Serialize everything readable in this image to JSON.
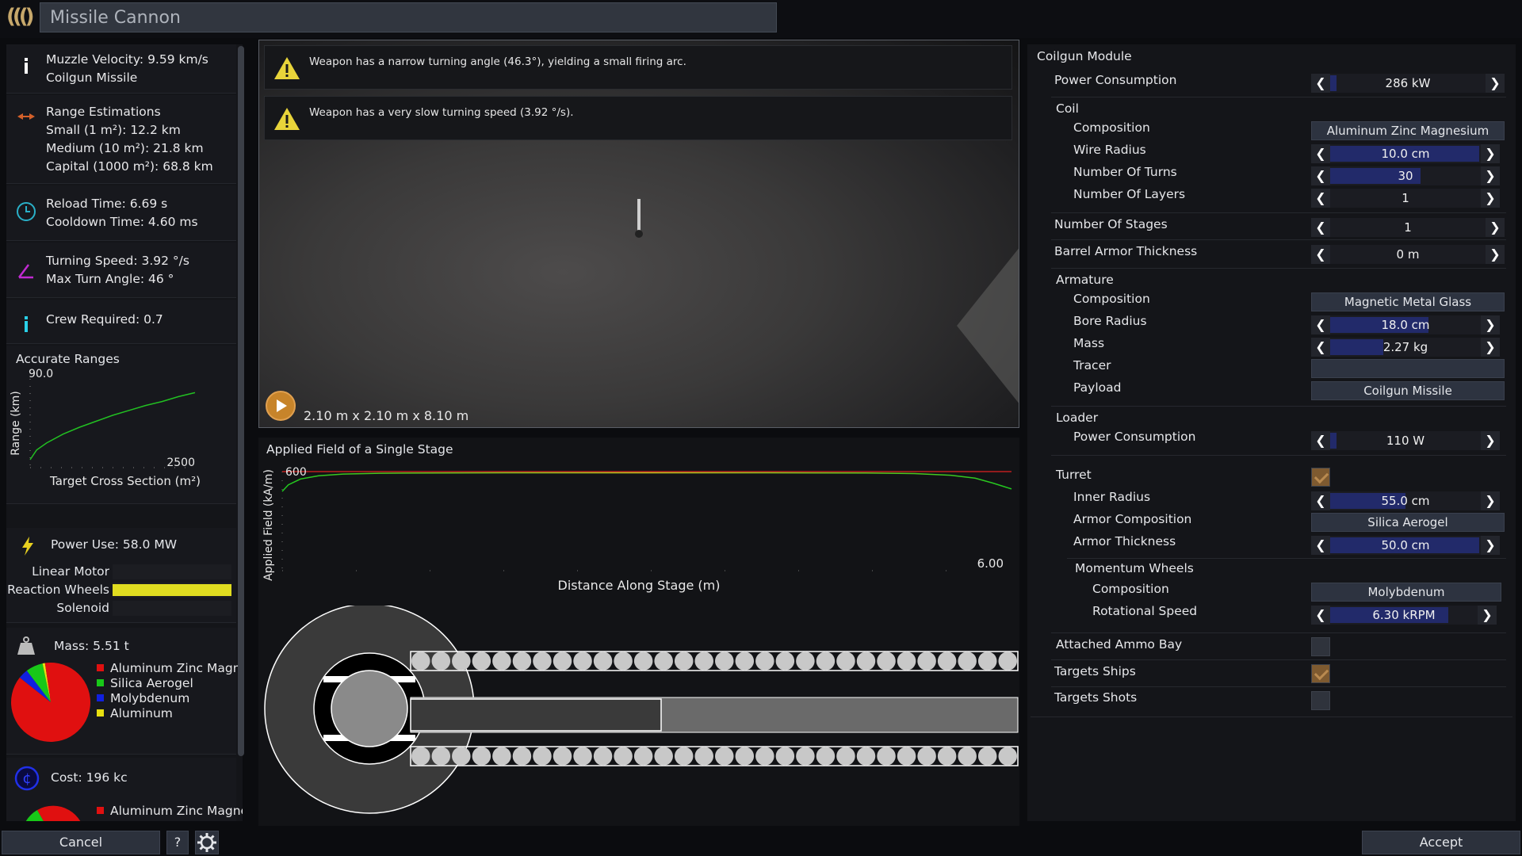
{
  "window": {
    "title": "Missile Cannon"
  },
  "left": {
    "muzzle": {
      "line1": "Muzzle Velocity: 9.59 km/s",
      "line2": "Coilgun Missile"
    },
    "range": {
      "title": "Range Estimations",
      "small": "Small (1 m²): 12.2 km",
      "medium": "Medium (10 m²): 21.8 km",
      "capital": "Capital (1000 m²): 68.8 km"
    },
    "reload": {
      "line1": "Reload Time: 6.69 s",
      "line2": "Cooldown Time: 4.60 ms"
    },
    "turning": {
      "line1": "Turning Speed: 3.92 °/s",
      "line2": "Max Turn Angle: 46 °"
    },
    "crew": {
      "line1": "Crew Required: 0.7"
    },
    "power": {
      "title": "Power Use: 58.0 MW",
      "bars": [
        {
          "label": "Linear Motor",
          "fraction": 0.0
        },
        {
          "label": "Reaction Wheels",
          "fraction": 1.0
        },
        {
          "label": "Solenoid",
          "fraction": 0.0
        }
      ]
    },
    "mass": {
      "title": "Mass: 5.51 t",
      "legend": [
        {
          "label": "Aluminum Zinc Magnes",
          "color": "#e01010",
          "fraction": 0.88
        },
        {
          "label": "Silica Aerogel",
          "color": "#18c818",
          "fraction": 0.07
        },
        {
          "label": "Molybdenum",
          "color": "#1020e0",
          "fraction": 0.04
        },
        {
          "label": "Aluminum",
          "color": "#e8e010",
          "fraction": 0.01
        }
      ]
    },
    "cost": {
      "title": "Cost: 196 kc",
      "legend": [
        {
          "label": "Aluminum Zinc Magnes",
          "color": "#e01010"
        }
      ]
    }
  },
  "chart_data": [
    {
      "type": "line",
      "title": "Accurate Ranges",
      "xlabel": "Target Cross Section (m²)",
      "ylabel": "Range (km)",
      "xlim": [
        0,
        2500
      ],
      "ylim": [
        0,
        90
      ],
      "x_tick_label": "2500",
      "y_tick_label": "90.0",
      "series": [
        {
          "color": "#22c022",
          "x": [
            0,
            100,
            250,
            500,
            750,
            1000,
            1250,
            1500,
            1750,
            2000,
            2250,
            2500
          ],
          "y": [
            8,
            18,
            25,
            34,
            41,
            47,
            53,
            58,
            63,
            67,
            72,
            76
          ]
        }
      ]
    },
    {
      "type": "line",
      "title": "Applied Field of a Single Stage",
      "xlabel": "Distance Along Stage (m)",
      "ylabel": "Applied Field (kA/m)",
      "xlim": [
        0,
        6
      ],
      "ylim": [
        0,
        600
      ],
      "x_tick_label": "6.00",
      "y_tick_label": "600",
      "limit_line": 600,
      "series": [
        {
          "x": [
            0,
            0.05,
            0.15,
            0.3,
            0.5,
            0.8,
            1.2,
            2,
            3,
            4,
            4.8,
            5.2,
            5.5,
            5.7,
            5.85,
            6.0
          ],
          "y": [
            480,
            520,
            555,
            575,
            585,
            590,
            592,
            593,
            593,
            593,
            592,
            588,
            578,
            560,
            530,
            495
          ]
        }
      ]
    }
  ],
  "viewport": {
    "warnings": [
      "Weapon has a narrow turning angle (46.3°), yielding a small firing arc.",
      "Weapon has a very slow turning speed (3.92 °/s)."
    ],
    "dimensions": "2.10 m x 2.10 m x 8.10 m"
  },
  "right": {
    "module_title": "Coilgun Module",
    "power_consumption": {
      "label": "Power Consumption",
      "value": "286 kW",
      "fraction": 0.04
    },
    "coil": {
      "title": "Coil",
      "composition": {
        "label": "Composition",
        "value": "Aluminum Zinc Magnesium"
      },
      "wire_radius": {
        "label": "Wire Radius",
        "value": "10.0 cm",
        "fraction": 0.99
      },
      "turns": {
        "label": "Number Of Turns",
        "value": "30",
        "fraction": 0.6
      },
      "layers": {
        "label": "Number Of Layers",
        "value": "1",
        "fraction": 0.0
      }
    },
    "stages": {
      "label": "Number Of Stages",
      "value": "1",
      "fraction": 0.0
    },
    "barrel_armor": {
      "label": "Barrel Armor Thickness",
      "value": "0 m",
      "fraction": 0.0
    },
    "armature": {
      "title": "Armature",
      "composition": {
        "label": "Composition",
        "value": "Magnetic Metal Glass"
      },
      "bore_radius": {
        "label": "Bore Radius",
        "value": "18.0 cm",
        "fraction": 0.65
      },
      "mass": {
        "label": "Mass",
        "value": "2.27 kg",
        "fraction": 0.35
      },
      "tracer": {
        "label": "Tracer",
        "value": ""
      },
      "payload": {
        "label": "Payload",
        "value": "Coilgun Missile"
      }
    },
    "loader": {
      "title": "Loader",
      "power": {
        "label": "Power Consumption",
        "value": "110 W",
        "fraction": 0.04
      }
    },
    "turret": {
      "title": "Turret",
      "enabled": true,
      "inner_radius": {
        "label": "Inner Radius",
        "value": "55.0 cm",
        "fraction": 0.5
      },
      "armor_composition": {
        "label": "Armor Composition",
        "value": "Silica Aerogel"
      },
      "armor_thickness": {
        "label": "Armor Thickness",
        "value": "50.0 cm",
        "fraction": 0.99
      },
      "wheels": {
        "title": "Momentum Wheels",
        "composition": {
          "label": "Composition",
          "value": "Molybdenum"
        },
        "speed": {
          "label": "Rotational Speed",
          "value": "6.30 kRPM",
          "fraction": 0.8
        }
      }
    },
    "ammo_bay": {
      "label": "Attached Ammo Bay",
      "checked": false
    },
    "targets_ships": {
      "label": "Targets Ships",
      "checked": true
    },
    "targets_shots": {
      "label": "Targets Shots",
      "checked": false
    }
  },
  "footer": {
    "cancel": "Cancel",
    "help": "?",
    "accept": "Accept"
  }
}
